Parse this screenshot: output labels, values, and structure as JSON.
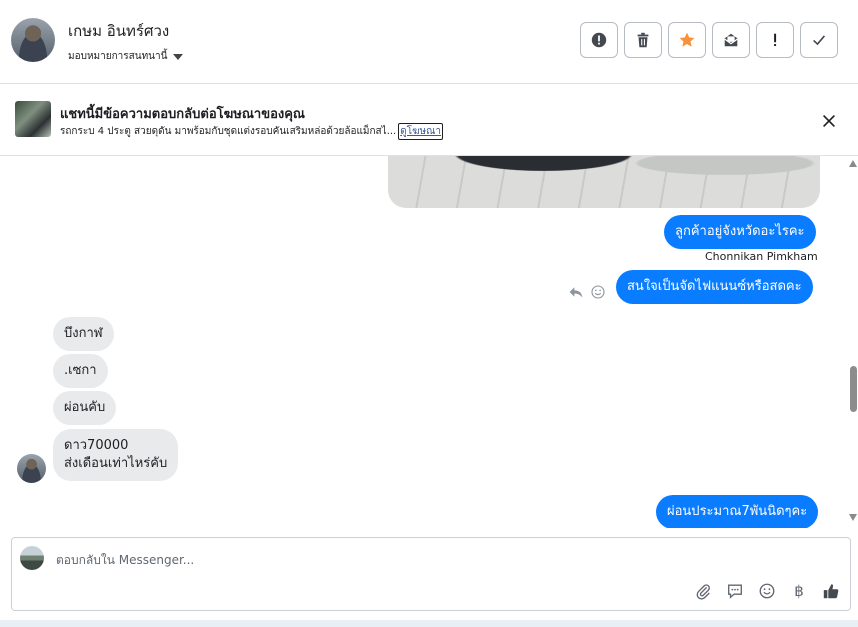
{
  "header": {
    "contact_name": "เกษม อินทร์ศวง",
    "assign_label": "มอบหมายการสนทนานี้",
    "tools": [
      {
        "name": "mark-spam-button",
        "icon": "alert-circle-icon"
      },
      {
        "name": "delete-button",
        "icon": "trash-icon"
      },
      {
        "name": "star-button",
        "icon": "star-icon"
      },
      {
        "name": "mark-unread-button",
        "icon": "envelope-icon"
      },
      {
        "name": "follow-up-button",
        "icon": "exclamation-icon"
      },
      {
        "name": "mark-done-button",
        "icon": "checkmark-icon"
      }
    ],
    "accent_star": "#f7923a"
  },
  "ad_banner": {
    "title": "แชทนี้มีข้อความตอบกลับต่อโฆษณาของคุณ",
    "description": "รถกระบ 4 ประตู สวยดุดัน มาพร้อมกับชุดแต่งรอบคันเสริมหล่อด้วยล้อแม็กสไ...",
    "link_label": "ดูโฆษณา"
  },
  "messages": {
    "out_1": "ลูกค้าอยู่จังหวัดอะไรคะ",
    "sender_name": "Chonnikan Pimkham",
    "out_2": "สนใจเป็นจัดไฟแนนซ์หรือสดคะ",
    "in_1": "บึงกาฬ",
    "in_2": ".เซกา",
    "in_3": "ผ่อนคับ",
    "in_4_line1": "ดาว70000",
    "in_4_line2": "ส่งเดือนเท่าไหร่คับ",
    "out_3": "ผ่อนประมาณ7พันนิดๆคะ",
    "outgoing_color": "#0a7cff",
    "incoming_color": "#e9eaec"
  },
  "composer": {
    "placeholder": "ตอบกลับใน Messenger...",
    "baht_symbol": "฿"
  }
}
